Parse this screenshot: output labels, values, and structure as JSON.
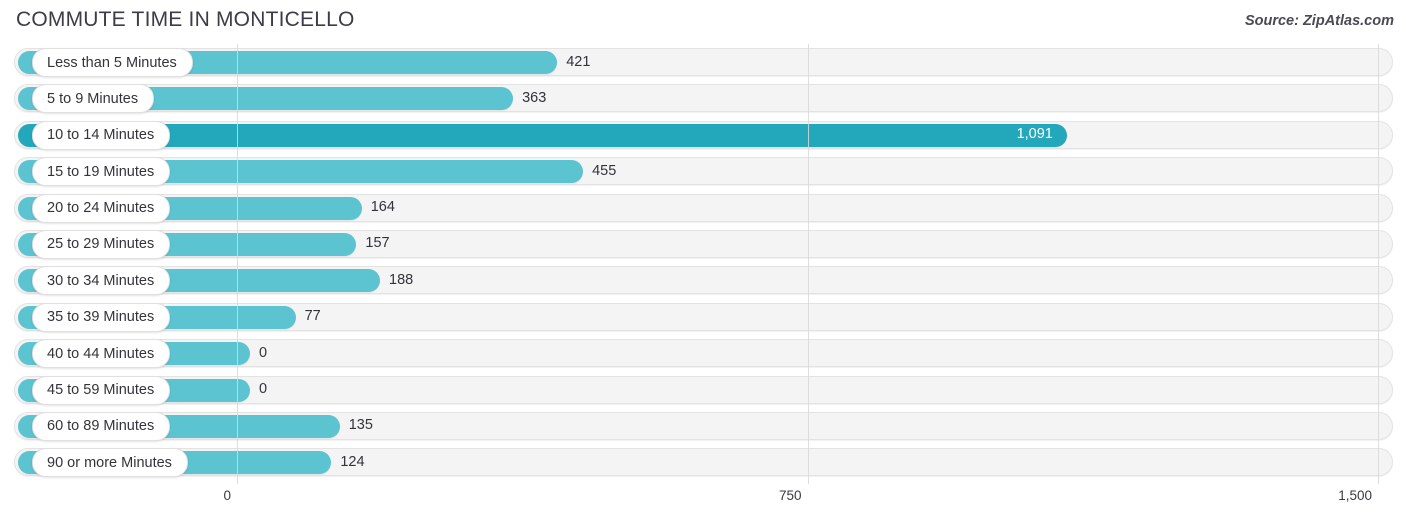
{
  "header": {
    "title": "COMMUTE TIME IN MONTICELLO",
    "source": "Source: ZipAtlas.com"
  },
  "colors": {
    "bar": "#5cc3d1",
    "bar_highlight": "#23a7bb",
    "track": "#f4f4f4",
    "gridline": "#d8d8d8",
    "text": "#33333b"
  },
  "chart_data": {
    "type": "bar",
    "orientation": "horizontal",
    "title": "COMMUTE TIME IN MONTICELLO",
    "xlabel": "",
    "ylabel": "",
    "xlim": [
      0,
      1500
    ],
    "grid": true,
    "legend": false,
    "source": "Source: ZipAtlas.com",
    "xticks": [
      "0",
      "750",
      "1,500"
    ],
    "xtick_values": [
      0,
      750,
      1500
    ],
    "categories": [
      "Less than 5 Minutes",
      "5 to 9 Minutes",
      "10 to 14 Minutes",
      "15 to 19 Minutes",
      "20 to 24 Minutes",
      "25 to 29 Minutes",
      "30 to 34 Minutes",
      "35 to 39 Minutes",
      "40 to 44 Minutes",
      "45 to 59 Minutes",
      "60 to 89 Minutes",
      "90 or more Minutes"
    ],
    "values": [
      421,
      363,
      1091,
      455,
      164,
      157,
      188,
      77,
      0,
      0,
      135,
      124
    ],
    "value_labels": [
      "421",
      "363",
      "1,091",
      "455",
      "164",
      "157",
      "188",
      "77",
      "0",
      "0",
      "135",
      "124"
    ],
    "highlight_index": 2
  }
}
